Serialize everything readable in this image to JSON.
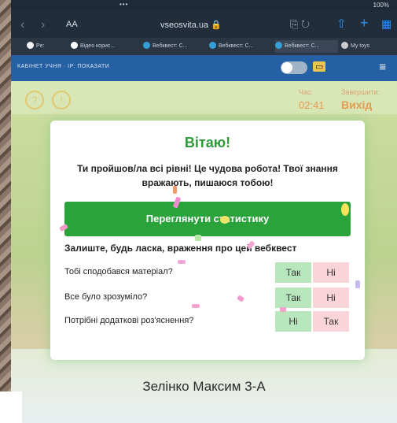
{
  "statusbar": {
    "dots": "•••",
    "battery": "100%"
  },
  "browser": {
    "back": "‹",
    "forward": "›",
    "aa": "AA",
    "url": "vseosvita.ua 🔒",
    "tabs": [
      {
        "label": "Pe:",
        "color": "#8aa3c7"
      },
      {
        "label": "Відео корис...",
        "color": "#ffffff"
      },
      {
        "label": "Вебквест: С...",
        "color": "#33a0d8"
      },
      {
        "label": "Вебквест: С...",
        "color": "#33a0d8"
      },
      {
        "label": "Вебквест: С...",
        "color": "#33a0d8"
      },
      {
        "label": "My toys",
        "color": "#cccccc"
      }
    ]
  },
  "site": {
    "cabinet": "КАБІНЕТ УЧНЯ · ІР: ПОКАЗАТИ",
    "timer_label": "Час:",
    "timer_value": "02:41",
    "finish_label": "Завершити:",
    "finish_value": "Вихід",
    "student": "Зелінко Максим 3-А"
  },
  "modal": {
    "title": "Вітаю!",
    "text": "Ти пройшов/ла всі рівні! Це чудова робота! Твої знання вражають, пишаюся тобою!",
    "stats_button": "Переглянути статистику",
    "feedback_title": "Залиште, будь ласка, враження про цей вебквест",
    "questions": [
      {
        "text": "Тобі сподобався матеріал?",
        "a1": "Так",
        "a2": "Ні"
      },
      {
        "text": "Все було зрозуміло?",
        "a1": "Так",
        "a2": "Ні"
      },
      {
        "text": "Потрібні додаткові роз'яснення?",
        "a1": "Ні",
        "a2": "Так"
      }
    ]
  },
  "colors": {
    "accent_green": "#2aa33a",
    "title_green": "#2e9a3a",
    "site_blue": "#2660a4"
  }
}
